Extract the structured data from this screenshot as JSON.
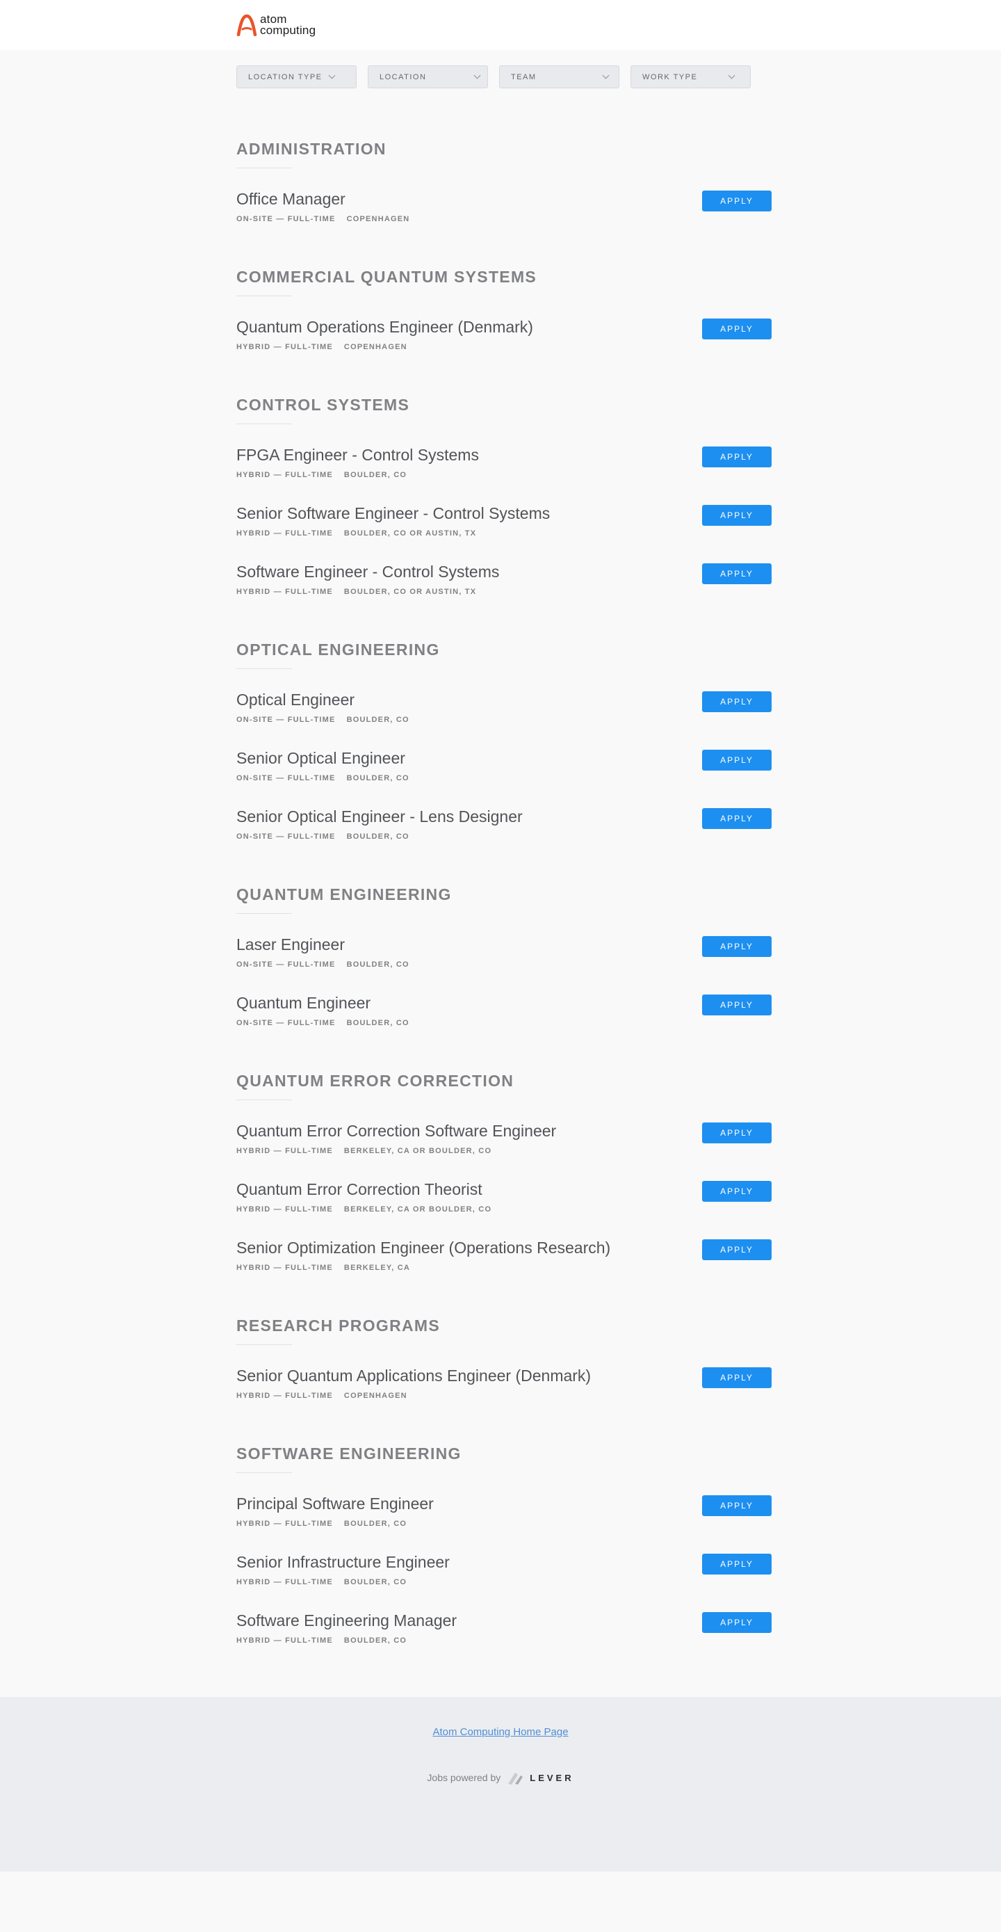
{
  "header": {
    "logo_line1": "atom",
    "logo_line2": "computing"
  },
  "filters": [
    {
      "label": "LOCATION TYPE"
    },
    {
      "label": "LOCATION"
    },
    {
      "label": "TEAM"
    },
    {
      "label": "WORK TYPE"
    }
  ],
  "apply_label": "APPLY",
  "groups": [
    {
      "title": "ADMINISTRATION",
      "postings": [
        {
          "title": "Office Manager",
          "type": "ON-SITE — FULL-TIME",
          "location": "COPENHAGEN"
        }
      ]
    },
    {
      "title": "COMMERCIAL QUANTUM SYSTEMS",
      "postings": [
        {
          "title": "Quantum Operations Engineer (Denmark)",
          "type": "HYBRID — FULL-TIME",
          "location": "COPENHAGEN"
        }
      ]
    },
    {
      "title": "CONTROL SYSTEMS",
      "postings": [
        {
          "title": "FPGA Engineer - Control Systems",
          "type": "HYBRID — FULL-TIME",
          "location": "BOULDER, CO"
        },
        {
          "title": "Senior Software Engineer - Control Systems",
          "type": "HYBRID — FULL-TIME",
          "location": "BOULDER, CO OR AUSTIN, TX"
        },
        {
          "title": "Software Engineer - Control Systems",
          "type": "HYBRID — FULL-TIME",
          "location": "BOULDER, CO OR AUSTIN, TX"
        }
      ]
    },
    {
      "title": "OPTICAL ENGINEERING",
      "postings": [
        {
          "title": "Optical Engineer",
          "type": "ON-SITE — FULL-TIME",
          "location": "BOULDER, CO"
        },
        {
          "title": "Senior Optical Engineer",
          "type": "ON-SITE — FULL-TIME",
          "location": "BOULDER, CO"
        },
        {
          "title": "Senior Optical Engineer - Lens Designer",
          "type": "ON-SITE — FULL-TIME",
          "location": "BOULDER, CO"
        }
      ]
    },
    {
      "title": "QUANTUM ENGINEERING",
      "postings": [
        {
          "title": "Laser Engineer",
          "type": "ON-SITE — FULL-TIME",
          "location": "BOULDER, CO"
        },
        {
          "title": "Quantum Engineer",
          "type": "ON-SITE — FULL-TIME",
          "location": "BOULDER, CO"
        }
      ]
    },
    {
      "title": "QUANTUM ERROR CORRECTION",
      "postings": [
        {
          "title": "Quantum Error Correction Software Engineer",
          "type": "HYBRID — FULL-TIME",
          "location": "BERKELEY, CA OR BOULDER, CO"
        },
        {
          "title": "Quantum Error Correction Theorist",
          "type": "HYBRID — FULL-TIME",
          "location": "BERKELEY, CA OR BOULDER, CO"
        },
        {
          "title": "Senior Optimization Engineer (Operations Research)",
          "type": "HYBRID — FULL-TIME",
          "location": "BERKELEY, CA"
        }
      ]
    },
    {
      "title": "RESEARCH PROGRAMS",
      "postings": [
        {
          "title": "Senior Quantum Applications Engineer (Denmark)",
          "type": "HYBRID — FULL-TIME",
          "location": "COPENHAGEN"
        }
      ]
    },
    {
      "title": "SOFTWARE ENGINEERING",
      "postings": [
        {
          "title": "Principal Software Engineer",
          "type": "HYBRID — FULL-TIME",
          "location": "BOULDER, CO"
        },
        {
          "title": "Senior Infrastructure Engineer",
          "type": "HYBRID — FULL-TIME",
          "location": "BOULDER, CO"
        },
        {
          "title": "Software Engineering Manager",
          "type": "HYBRID — FULL-TIME",
          "location": "BOULDER, CO"
        }
      ]
    }
  ],
  "footer": {
    "home_link": "Atom Computing Home Page",
    "powered_by": "Jobs powered by",
    "lever_word": "LEVER"
  },
  "colors": {
    "accent": "#1d8ff0",
    "logo_orange": "#e8552a",
    "link": "#4f8fd6"
  }
}
